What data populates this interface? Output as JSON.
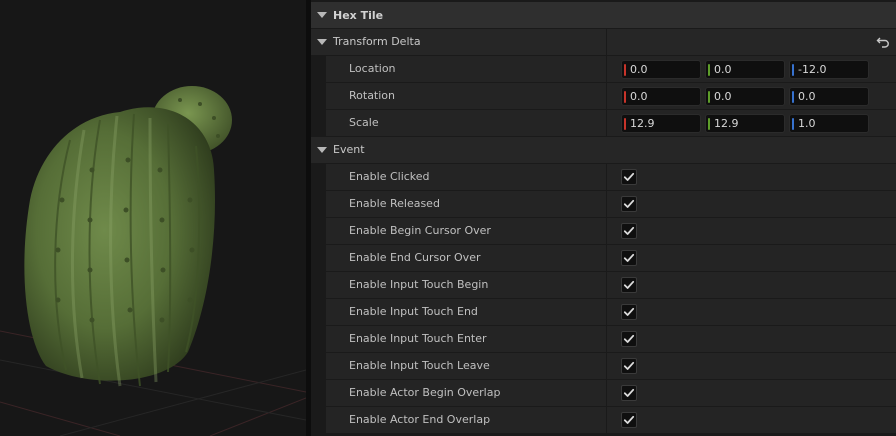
{
  "viewport": {
    "object": "cactus-mesh"
  },
  "details": {
    "hex_tile": {
      "label": "Hex Tile"
    },
    "transform": {
      "label": "Transform Delta",
      "reset_icon": "reset-arrow-icon",
      "location": {
        "label": "Location",
        "x": "0.0",
        "y": "0.0",
        "z": "-12.0"
      },
      "rotation": {
        "label": "Rotation",
        "x": "0.0",
        "y": "0.0",
        "z": "0.0"
      },
      "scale": {
        "label": "Scale",
        "x": "12.9",
        "y": "12.9",
        "z": "1.0"
      }
    },
    "event": {
      "label": "Event",
      "items": [
        {
          "label": "Enable Clicked",
          "checked": true
        },
        {
          "label": "Enable Released",
          "checked": true
        },
        {
          "label": "Enable Begin Cursor Over",
          "checked": true
        },
        {
          "label": "Enable End Cursor Over",
          "checked": true
        },
        {
          "label": "Enable Input Touch Begin",
          "checked": true
        },
        {
          "label": "Enable Input Touch End",
          "checked": true
        },
        {
          "label": "Enable Input Touch Enter",
          "checked": true
        },
        {
          "label": "Enable Input Touch Leave",
          "checked": true
        },
        {
          "label": "Enable Actor Begin Overlap",
          "checked": true
        },
        {
          "label": "Enable Actor End Overlap",
          "checked": true
        }
      ]
    },
    "colors": {
      "x_axis": "#c8342a",
      "y_axis": "#5e9e2a",
      "z_axis": "#3772cf",
      "check": "#dcdcdc"
    }
  }
}
